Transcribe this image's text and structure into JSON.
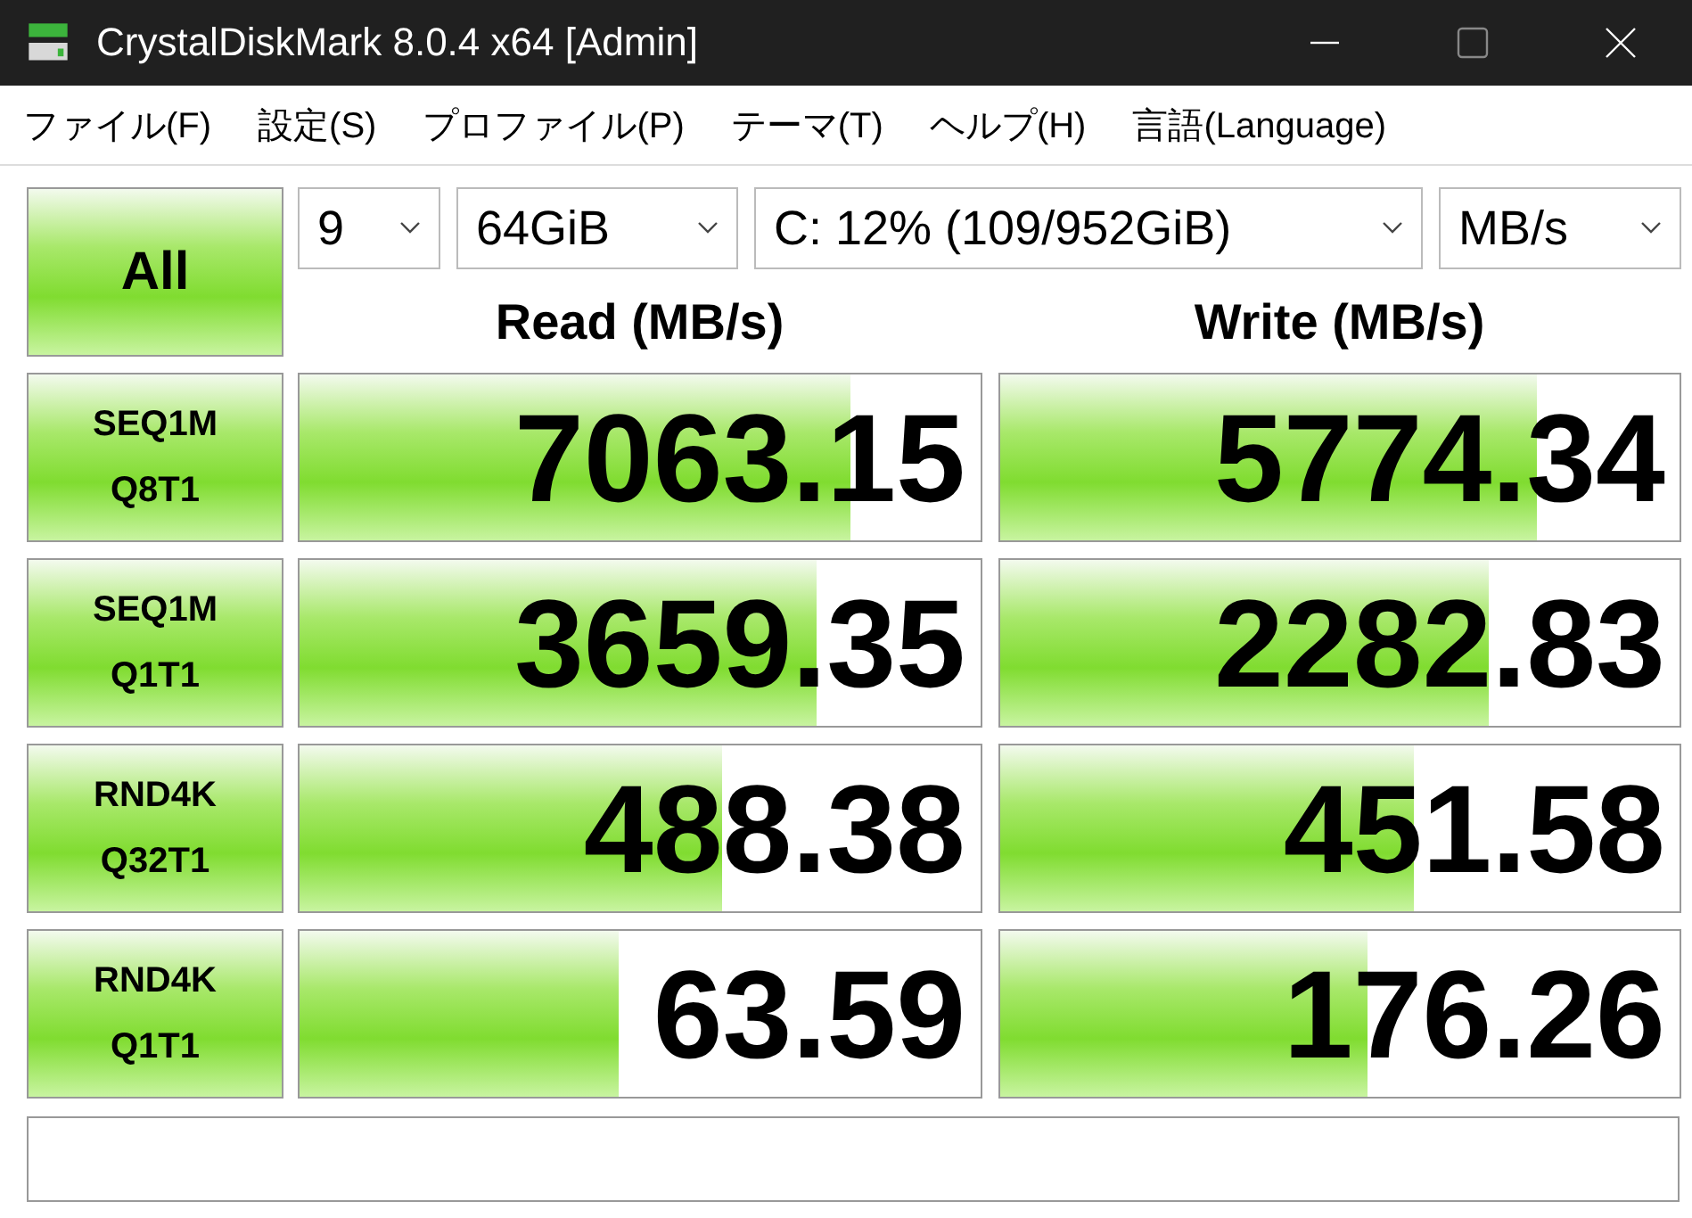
{
  "window": {
    "title": "CrystalDiskMark 8.0.4 x64 [Admin]"
  },
  "menu": [
    "ファイル(F)",
    "設定(S)",
    "プロファイル(P)",
    "テーマ(T)",
    "ヘルプ(H)",
    "言語(Language)"
  ],
  "all_button": "All",
  "selects": [
    {
      "value": "9"
    },
    {
      "value": "64GiB"
    },
    {
      "value": "C: 12% (109/952GiB)"
    },
    {
      "value": "MB/s"
    }
  ],
  "columns": [
    "Read (MB/s)",
    "Write (MB/s)"
  ],
  "tests": [
    {
      "line1": "SEQ1M",
      "line2": "Q8T1",
      "read": {
        "value": "7063.15",
        "level": 0.81
      },
      "write": {
        "value": "5774.34",
        "level": 0.79
      }
    },
    {
      "line1": "SEQ1M",
      "line2": "Q1T1",
      "read": {
        "value": "3659.35",
        "level": 0.76
      },
      "write": {
        "value": "2282.83",
        "level": 0.72
      }
    },
    {
      "line1": "RND4K",
      "line2": "Q32T1",
      "read": {
        "value": "488.38",
        "level": 0.62
      },
      "write": {
        "value": "451.58",
        "level": 0.61
      }
    },
    {
      "line1": "RND4K",
      "line2": "Q1T1",
      "read": {
        "value": "63.59",
        "level": 0.47
      },
      "write": {
        "value": "176.26",
        "level": 0.54
      }
    }
  ]
}
